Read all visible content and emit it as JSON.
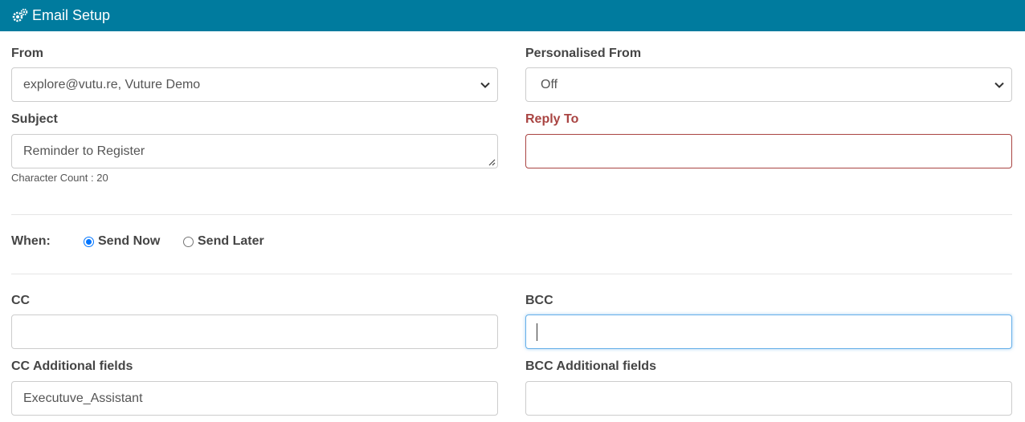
{
  "header": {
    "title": "Email Setup",
    "icon": "gears-icon"
  },
  "from": {
    "label": "From",
    "value": "explore@vutu.re, Vuture Demo"
  },
  "personalised_from": {
    "label": "Personalised From",
    "value": "Off"
  },
  "subject": {
    "label": "Subject",
    "value": "Reminder to Register",
    "char_count": "Character Count : 20"
  },
  "reply_to": {
    "label": "Reply To",
    "value": ""
  },
  "when": {
    "label": "When:",
    "options": [
      {
        "label": "Send Now",
        "checked": true
      },
      {
        "label": "Send Later",
        "checked": false
      }
    ]
  },
  "cc": {
    "label": "CC",
    "value": ""
  },
  "bcc": {
    "label": "BCC",
    "value": ""
  },
  "cc_additional": {
    "label": "CC Additional fields",
    "value": "Executuve_Assistant"
  },
  "bcc_additional": {
    "label": "BCC Additional fields",
    "value": ""
  },
  "colors": {
    "header_bg": "#007b9e",
    "error": "#a94442",
    "focus": "#66afe9",
    "radio": "#0075ff"
  }
}
